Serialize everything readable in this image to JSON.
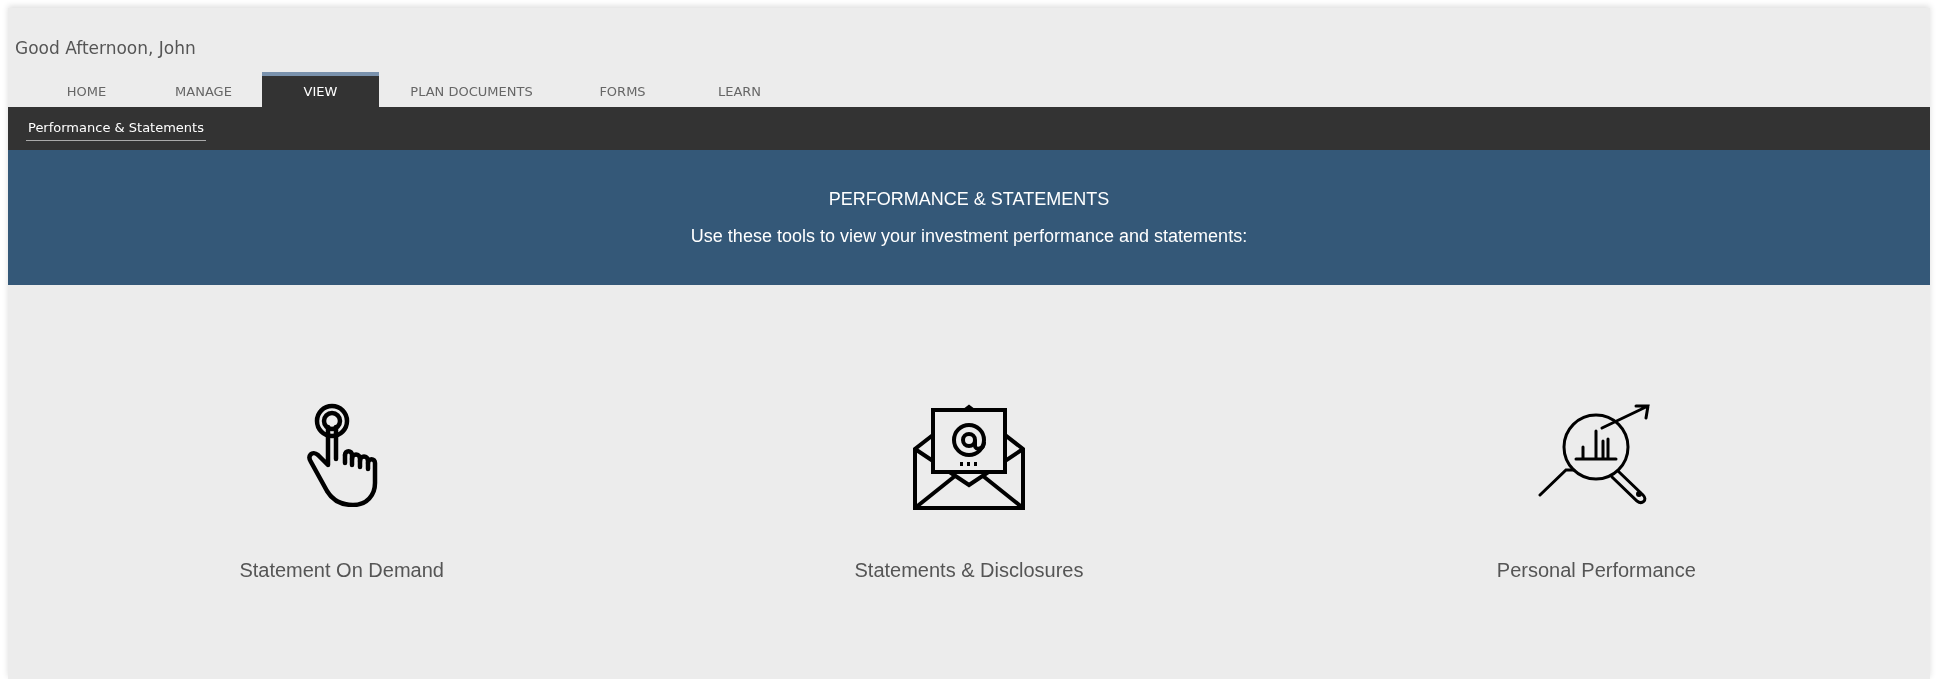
{
  "greeting": "Good Afternoon, John",
  "tabs": [
    {
      "label": "HOME",
      "selected": false
    },
    {
      "label": "MANAGE",
      "selected": false
    },
    {
      "label": "VIEW",
      "selected": true
    },
    {
      "label": "PLAN DOCUMENTS",
      "selected": false
    },
    {
      "label": "FORMS",
      "selected": false
    },
    {
      "label": "LEARN",
      "selected": false
    }
  ],
  "subnav": [
    {
      "label": "Performance & Statements",
      "selected": true
    }
  ],
  "banner": {
    "title": "PERFORMANCE & STATEMENTS",
    "subtitle": "Use these tools to view your investment performance and statements:"
  },
  "tools": [
    {
      "kind": "touch",
      "label": "Statement On Demand"
    },
    {
      "kind": "mail",
      "label": "Statements & Disclosures"
    },
    {
      "kind": "analytics",
      "label": "Personal Performance"
    }
  ]
}
